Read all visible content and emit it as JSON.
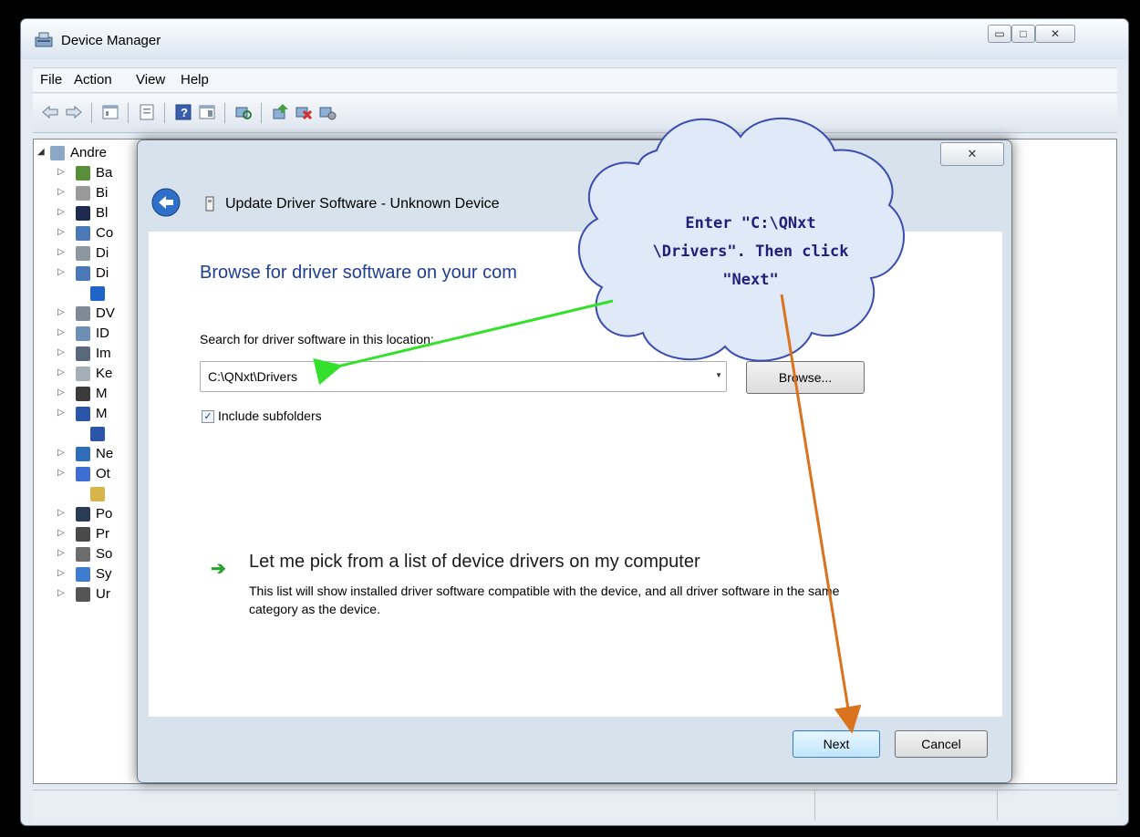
{
  "window": {
    "title": "Device Manager",
    "controls": {
      "minimize": "▭",
      "maximize": "□",
      "close": "✕"
    }
  },
  "menu": [
    "File",
    "Action",
    "View",
    "Help"
  ],
  "tree": {
    "root": "Andre",
    "items": [
      "Ba",
      "Bi",
      "Bl",
      "Co",
      "Di",
      "Di",
      "",
      "DV",
      "ID",
      "Im",
      "Ke",
      "M",
      "M",
      "",
      "Ne",
      "Ot",
      "",
      "Po",
      "Pr",
      "So",
      "Sy",
      "Ur"
    ]
  },
  "dialog": {
    "close_glyph": "✕",
    "title": "Update Driver Software - Unknown Device",
    "heading": "Browse for driver software on your com",
    "search_label": "Search for driver software in this location:",
    "path_value": "C:\\QNxt\\Drivers",
    "browse_label": "Browse...",
    "include_subfolders": "Include subfolders",
    "pick_title": "Let me pick from a list of device drivers on my computer",
    "pick_desc": "This list will show installed driver software compatible with the device, and all driver software in the same category as the device.",
    "next_label": "Next",
    "cancel_label": "Cancel"
  },
  "callout": {
    "lines": [
      "Enter \"C:\\QNxt",
      "\\Drivers\". Then click",
      "\"Next\""
    ],
    "colors": {
      "green_arrow": "#34e02c",
      "orange_arrow": "#d9731e",
      "cloud_fill": "#dfe9f8",
      "cloud_stroke": "#3b4db0"
    }
  }
}
